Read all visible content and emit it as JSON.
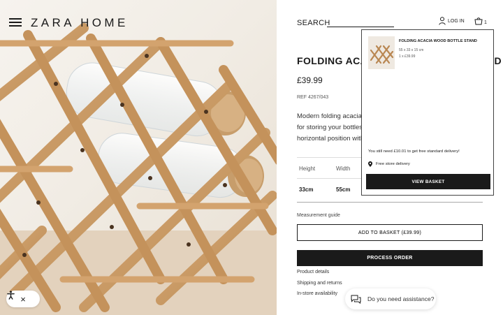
{
  "header": {
    "brand": "ZARA HOME",
    "search_label": "SEARCH",
    "login_label": "LOG IN",
    "basket_count": "1"
  },
  "product": {
    "title": "FOLDING ACACIA WOOD BOTTLE STAND",
    "price": "£39.99",
    "ref": "REF 4267/043",
    "description_lines": [
      "Modern folding acacia wood bottle stand,",
      "for storing your bottles in a",
      "horizontal position without them"
    ],
    "dimensions": {
      "headers": [
        "Height",
        "Width"
      ],
      "values": [
        "33cm",
        "55cm"
      ]
    },
    "measurement_guide": "Measurement guide",
    "add_to_basket": "ADD TO BASKET (£39.99)",
    "process_order": "PROCESS ORDER",
    "links": [
      "Product details",
      "Shipping and returns",
      "In-store availability"
    ]
  },
  "basket_popup": {
    "item_name": "FOLDING ACACIA WOOD BOTTLE STAND",
    "item_size": "55 x 33 x 15 cm",
    "item_qty": "1 x £39.99",
    "delivery_message": "You still need £10.01 to get free standard delivery!",
    "store_delivery": "Free store delivery",
    "view_basket": "VIEW BASKET"
  },
  "assistant": {
    "label": "Do you need assistance?"
  },
  "accessibility": {
    "close_label": "×"
  },
  "icons": [
    "menu-icon",
    "user-icon",
    "basket-icon",
    "location-pin-icon",
    "chat-icon",
    "accessibility-icon",
    "close-icon"
  ]
}
